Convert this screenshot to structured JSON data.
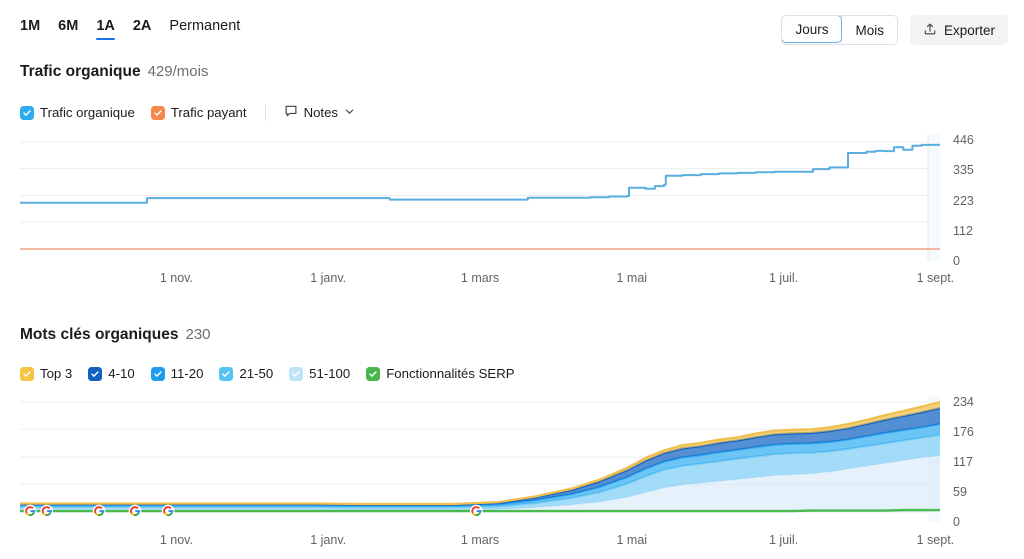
{
  "toolbar": {
    "ranges": [
      {
        "label": "1M",
        "active": false
      },
      {
        "label": "6M",
        "active": false
      },
      {
        "label": "1A",
        "active": true
      },
      {
        "label": "2A",
        "active": false
      },
      {
        "label": "Permanent",
        "active": false
      }
    ],
    "granularity": {
      "days_label": "Jours",
      "months_label": "Mois",
      "selected": "Jours"
    },
    "export_label": "Exporter",
    "export_icon": "upload-icon"
  },
  "traffic_section": {
    "title": "Trafic organique",
    "value": "429/mois",
    "legend": [
      {
        "label": "Trafic organique",
        "color": "#2eacf0",
        "checked": true
      },
      {
        "label": "Trafic payant",
        "color": "#f3894a",
        "checked": true
      }
    ],
    "notes_label": "Notes",
    "notes_icon": "note-bubble-icon",
    "chevron_icon": "chevron-down-icon"
  },
  "keywords_section": {
    "title": "Mots clés organiques",
    "value": "230",
    "legend": [
      {
        "label": "Top 3",
        "color": "#f6c344",
        "checked": true
      },
      {
        "label": "4-10",
        "color": "#1262c2",
        "checked": true
      },
      {
        "label": "11-20",
        "color": "#1f9bf0",
        "checked": true
      },
      {
        "label": "21-50",
        "color": "#56c3f5",
        "checked": true
      },
      {
        "label": "51-100",
        "color": "#bfe2f7",
        "checked": true
      },
      {
        "label": "Fonctionnalités SERP",
        "color": "#47b74b",
        "checked": true
      }
    ]
  },
  "chart_data": [
    {
      "id": "organic-traffic-chart",
      "type": "line",
      "title": "Trafic organique",
      "xlabel": "",
      "ylabel": "",
      "grid": true,
      "legend_position": "above",
      "yticks": [
        446,
        335,
        223,
        112,
        0
      ],
      "ylim": [
        0,
        446
      ],
      "xticks": [
        "1 nov.",
        "1 janv.",
        "1 mars",
        "1 mai",
        "1 juil.",
        "1 sept."
      ],
      "xtick_positions": [
        0.17,
        0.335,
        0.5,
        0.665,
        0.83,
        0.995
      ],
      "series": [
        {
          "name": "Trafic organique",
          "color": "#5aaee0",
          "x": [
            0,
            0.02,
            0.06,
            0.1,
            0.135,
            0.138,
            0.2,
            0.28,
            0.36,
            0.4,
            0.402,
            0.46,
            0.52,
            0.55,
            0.552,
            0.6,
            0.62,
            0.64,
            0.66,
            0.662,
            0.68,
            0.69,
            0.7,
            0.702,
            0.72,
            0.74,
            0.76,
            0.78,
            0.8,
            0.82,
            0.84,
            0.86,
            0.862,
            0.88,
            0.9,
            0.92,
            0.93,
            0.94,
            0.95,
            0.96,
            0.97,
            0.98,
            1.0
          ],
          "values": [
            193,
            193,
            193,
            193,
            193,
            212,
            212,
            212,
            212,
            212,
            206,
            206,
            206,
            206,
            214,
            214,
            216,
            219,
            221,
            255,
            251,
            262,
            268,
            305,
            308,
            312,
            315,
            317,
            320,
            322,
            322,
            322,
            333,
            340,
            400,
            405,
            409,
            408,
            424,
            414,
            430,
            434,
            436
          ]
        },
        {
          "name": "Trafic payant",
          "color": "#f0b090",
          "x": [
            0,
            1.0
          ],
          "values": [
            0,
            0
          ]
        }
      ]
    },
    {
      "id": "organic-keywords-chart",
      "type": "area",
      "stacked": true,
      "title": "Mots clés organiques",
      "xlabel": "",
      "ylabel": "",
      "grid": true,
      "legend_position": "above",
      "yticks": [
        234,
        176,
        117,
        59,
        0
      ],
      "ylim": [
        0,
        234
      ],
      "xticks": [
        "1 nov.",
        "1 janv.",
        "1 mars",
        "1 mai",
        "1 juil.",
        "1 sept."
      ],
      "xtick_positions": [
        0.17,
        0.335,
        0.5,
        0.665,
        0.83,
        0.995
      ],
      "x": [
        0,
        0.04,
        0.08,
        0.12,
        0.17,
        0.22,
        0.27,
        0.32,
        0.37,
        0.42,
        0.47,
        0.52,
        0.56,
        0.6,
        0.63,
        0.66,
        0.68,
        0.7,
        0.72,
        0.74,
        0.76,
        0.78,
        0.8,
        0.82,
        0.84,
        0.86,
        0.88,
        0.9,
        0.92,
        0.94,
        0.96,
        0.98,
        1.0
      ],
      "series": [
        {
          "name": "51-100",
          "color": "#cfe6f7",
          "values": [
            6,
            6,
            6,
            6,
            6,
            6,
            6,
            6,
            5,
            5,
            5,
            6,
            10,
            16,
            22,
            32,
            42,
            52,
            58,
            62,
            66,
            70,
            74,
            78,
            80,
            82,
            86,
            92,
            98,
            104,
            110,
            116,
            120
          ]
        },
        {
          "name": "21-50",
          "color": "#7fcef5",
          "values": [
            5,
            5,
            5,
            5,
            5,
            5,
            5,
            5,
            5,
            5,
            5,
            6,
            9,
            14,
            20,
            28,
            34,
            38,
            40,
            41,
            42,
            43,
            44,
            45,
            45,
            44,
            43,
            42,
            42,
            42,
            42,
            42,
            44
          ]
        },
        {
          "name": "11-20",
          "color": "#35aef2",
          "values": [
            3,
            3,
            3,
            3,
            3,
            3,
            3,
            3,
            3,
            3,
            3,
            4,
            6,
            8,
            11,
            14,
            16,
            17,
            18,
            18,
            19,
            19,
            20,
            20,
            20,
            20,
            20,
            20,
            21,
            22,
            22,
            22,
            23
          ]
        },
        {
          "name": "4-10",
          "color": "#1262c2",
          "values": [
            3,
            3,
            3,
            3,
            3,
            3,
            3,
            3,
            3,
            3,
            3,
            4,
            6,
            9,
            12,
            15,
            17,
            18,
            19,
            19,
            20,
            20,
            21,
            22,
            22,
            22,
            23,
            24,
            26,
            28,
            30,
            32,
            34
          ]
        },
        {
          "name": "Top 3",
          "color": "#f0bf4c",
          "values": [
            1,
            1,
            1,
            1,
            1,
            1,
            1,
            1,
            1,
            1,
            1,
            1,
            2,
            3,
            4,
            5,
            6,
            6,
            7,
            7,
            7,
            7,
            8,
            8,
            8,
            8,
            8,
            9,
            9,
            10,
            11,
            12,
            13
          ]
        }
      ],
      "serp_line": {
        "name": "Fonctionnalités SERP",
        "color": "#49ba4e",
        "values": [
          2,
          2,
          2,
          2,
          2,
          2,
          2,
          2,
          2,
          2,
          2,
          2,
          2,
          2,
          2,
          2,
          2,
          2,
          2,
          2,
          2,
          2,
          2,
          2,
          2,
          3,
          3,
          3,
          3,
          3,
          4,
          4,
          4
        ]
      },
      "google_update_markers": [
        0.011,
        0.029,
        0.086,
        0.125,
        0.161,
        0.496
      ]
    }
  ]
}
